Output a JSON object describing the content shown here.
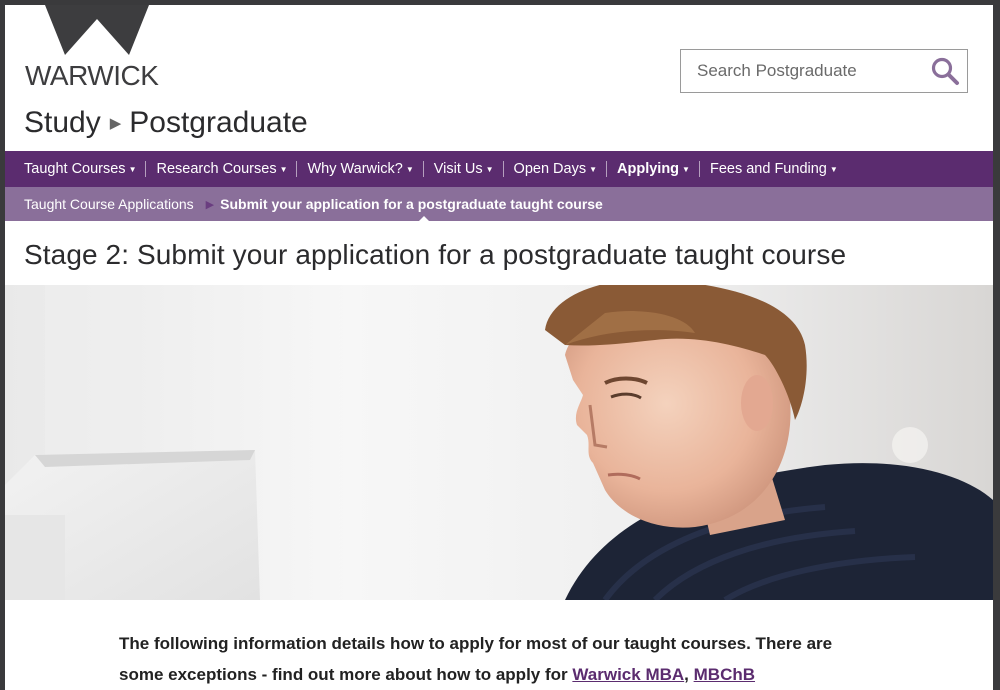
{
  "header": {
    "logo_text": "WARWICK",
    "search_placeholder": "Search Postgraduate",
    "title_parent": "Study",
    "title_current": "Postgraduate"
  },
  "nav": {
    "items": [
      {
        "label": "Taught Courses",
        "active": false
      },
      {
        "label": "Research Courses",
        "active": false
      },
      {
        "label": "Why Warwick?",
        "active": false
      },
      {
        "label": "Visit Us",
        "active": false
      },
      {
        "label": "Open Days",
        "active": false
      },
      {
        "label": "Applying",
        "active": true
      },
      {
        "label": "Fees and Funding",
        "active": false
      }
    ]
  },
  "breadcrumb": {
    "parent": "Taught Course Applications",
    "current": "Submit your application for a postgraduate taught course"
  },
  "page": {
    "heading": "Stage 2: Submit your application for a postgraduate taught course",
    "intro_text": "The following information details how to apply for most of our taught courses. There are some exceptions - find out more about how to apply for",
    "intro_sep": ",",
    "link_mba": "Warwick MBA",
    "link_mbchb": "MBChB"
  },
  "colors": {
    "nav_bg": "#5b2c6f",
    "breadcrumb_bg": "#8a6f9a",
    "logo_mark": "#3d3d3f",
    "link": "#5b2c6f"
  },
  "icons": {
    "logo": "warwick-w-logo",
    "search": "search-icon",
    "title_separator": "triangle-right-icon",
    "dropdown": "caret-down-icon"
  }
}
